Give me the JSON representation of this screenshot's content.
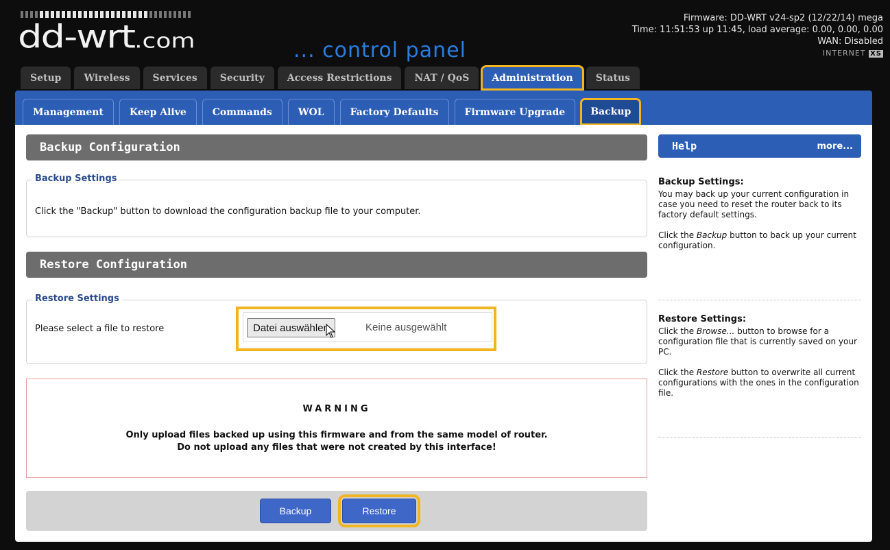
{
  "header": {
    "logo_text": "dd-wrt",
    "logo_suffix": ".com",
    "tagline": "... control panel",
    "firmware": "Firmware: DD-WRT v24-sp2 (12/22/14) mega",
    "time": "Time: 11:51:53 up 11:45, load average: 0.00, 0.00, 0.00",
    "wan": "WAN: Disabled",
    "internet": "INTERNET",
    "internet_badge": "XS"
  },
  "main_tabs": [
    {
      "label": "Setup"
    },
    {
      "label": "Wireless"
    },
    {
      "label": "Services"
    },
    {
      "label": "Security"
    },
    {
      "label": "Access Restrictions"
    },
    {
      "label": "NAT / QoS"
    },
    {
      "label": "Administration"
    },
    {
      "label": "Status"
    }
  ],
  "sub_tabs": [
    {
      "label": "Management"
    },
    {
      "label": "Keep Alive"
    },
    {
      "label": "Commands"
    },
    {
      "label": "WOL"
    },
    {
      "label": "Factory Defaults"
    },
    {
      "label": "Firmware Upgrade"
    },
    {
      "label": "Backup"
    }
  ],
  "backup": {
    "section_title": "Backup Configuration",
    "legend": "Backup Settings",
    "text": "Click the \"Backup\" button to download the configuration backup file to your computer."
  },
  "restore": {
    "section_title": "Restore Configuration",
    "legend": "Restore Settings",
    "label": "Please select a file to restore",
    "choose_button": "Datei auswählen",
    "no_file": "Keine ausgewählt"
  },
  "warning": {
    "title": "WARNING",
    "line1": "Only upload files backed up using this firmware and from the same model of router.",
    "line2": "Do not upload any files that were not created by this interface!"
  },
  "buttons": {
    "backup": "Backup",
    "restore": "Restore"
  },
  "help": {
    "title": "Help",
    "more": "more...",
    "backup_heading": "Backup Settings:",
    "backup_p1": "You may back up your current configuration in case you need to reset the router back to its factory default settings.",
    "backup_p2_pre": "Click the ",
    "backup_p2_em": "Backup",
    "backup_p2_post": " button to back up your current configuration.",
    "restore_heading": "Restore Settings:",
    "restore_p1_pre": "Click the ",
    "restore_p1_em": "Browse...",
    "restore_p1_post": " button to browse for a configuration file that is currently saved on your PC.",
    "restore_p2_pre": "Click the ",
    "restore_p2_em": "Restore",
    "restore_p2_post": " button to overwrite all current configurations with the ones in the configuration file."
  },
  "colors": {
    "accent_blue": "#2c5eb5",
    "highlight": "#f0b51f",
    "section_gray": "#6d6d6d"
  }
}
